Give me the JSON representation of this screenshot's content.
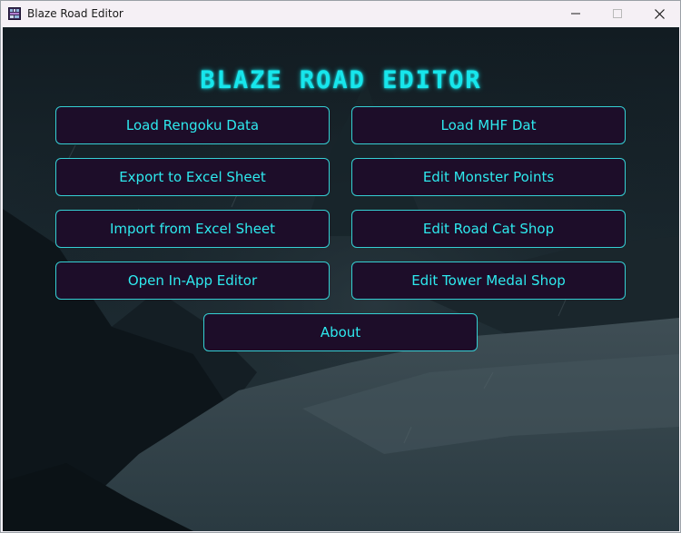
{
  "window": {
    "title": "Blaze Road Editor",
    "controls": {
      "minimize_icon": "minimize-icon",
      "maximize_icon": "maximize-icon",
      "close_icon": "close-icon"
    }
  },
  "app": {
    "heading": "BLAZE ROAD EDITOR",
    "accent_color": "#17e6ec",
    "button_bg": "#1d0d29",
    "buttons": {
      "load_rengoku": "Load Rengoku Data",
      "load_mhf": "Load MHF Dat",
      "export_excel": "Export to Excel Sheet",
      "edit_monster_points": "Edit Monster Points",
      "import_excel": "Import from Excel Sheet",
      "edit_road_cat_shop": "Edit Road Cat Shop",
      "open_in_app_editor": "Open In-App Editor",
      "edit_tower_medal_shop": "Edit Tower Medal Shop",
      "about": "About"
    }
  }
}
